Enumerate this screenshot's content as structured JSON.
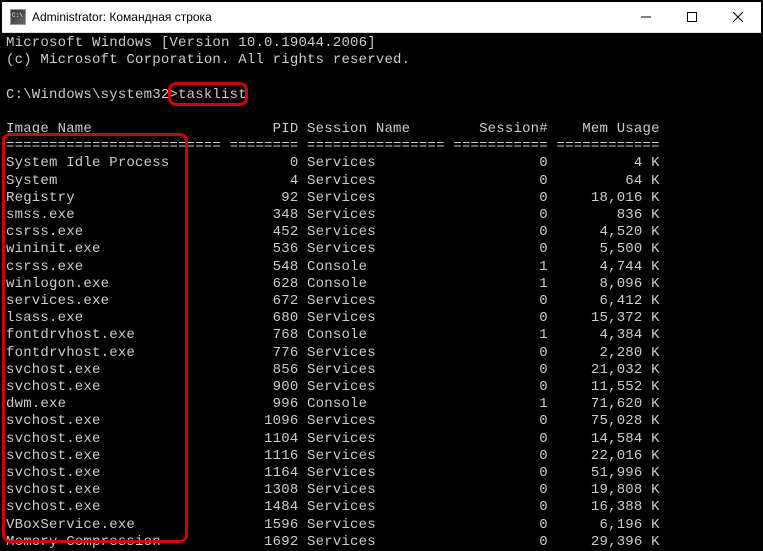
{
  "window": {
    "title": "Administrator: Командная строка"
  },
  "header": {
    "line1": "Microsoft Windows [Version 10.0.19044.2006]",
    "line2": "(c) Microsoft Corporation. All rights reserved."
  },
  "prompt": {
    "path": "C:\\Windows\\system32>",
    "command": "tasklist"
  },
  "columns": {
    "c1": "Image Name",
    "c2": "PID",
    "c3": "Session Name",
    "c4": "Session#",
    "c5": "Mem Usage"
  },
  "sep": "========================= ======== ================ =========== ============",
  "rows": [
    {
      "name": "System Idle Process",
      "pid": "0",
      "sess": "Services",
      "sn": "0",
      "mem": "4 K"
    },
    {
      "name": "System",
      "pid": "4",
      "sess": "Services",
      "sn": "0",
      "mem": "64 K"
    },
    {
      "name": "Registry",
      "pid": "92",
      "sess": "Services",
      "sn": "0",
      "mem": "18,016 K"
    },
    {
      "name": "smss.exe",
      "pid": "348",
      "sess": "Services",
      "sn": "0",
      "mem": "836 K"
    },
    {
      "name": "csrss.exe",
      "pid": "452",
      "sess": "Services",
      "sn": "0",
      "mem": "4,520 K"
    },
    {
      "name": "wininit.exe",
      "pid": "536",
      "sess": "Services",
      "sn": "0",
      "mem": "5,500 K"
    },
    {
      "name": "csrss.exe",
      "pid": "548",
      "sess": "Console",
      "sn": "1",
      "mem": "4,744 K"
    },
    {
      "name": "winlogon.exe",
      "pid": "628",
      "sess": "Console",
      "sn": "1",
      "mem": "8,096 K"
    },
    {
      "name": "services.exe",
      "pid": "672",
      "sess": "Services",
      "sn": "0",
      "mem": "6,412 K"
    },
    {
      "name": "lsass.exe",
      "pid": "680",
      "sess": "Services",
      "sn": "0",
      "mem": "15,372 K"
    },
    {
      "name": "fontdrvhost.exe",
      "pid": "768",
      "sess": "Console",
      "sn": "1",
      "mem": "4,384 K"
    },
    {
      "name": "fontdrvhost.exe",
      "pid": "776",
      "sess": "Services",
      "sn": "0",
      "mem": "2,280 K"
    },
    {
      "name": "svchost.exe",
      "pid": "856",
      "sess": "Services",
      "sn": "0",
      "mem": "21,032 K"
    },
    {
      "name": "svchost.exe",
      "pid": "900",
      "sess": "Services",
      "sn": "0",
      "mem": "11,552 K"
    },
    {
      "name": "dwm.exe",
      "pid": "996",
      "sess": "Console",
      "sn": "1",
      "mem": "71,620 K"
    },
    {
      "name": "svchost.exe",
      "pid": "1096",
      "sess": "Services",
      "sn": "0",
      "mem": "75,028 K"
    },
    {
      "name": "svchost.exe",
      "pid": "1104",
      "sess": "Services",
      "sn": "0",
      "mem": "14,584 K"
    },
    {
      "name": "svchost.exe",
      "pid": "1116",
      "sess": "Services",
      "sn": "0",
      "mem": "22,016 K"
    },
    {
      "name": "svchost.exe",
      "pid": "1164",
      "sess": "Services",
      "sn": "0",
      "mem": "51,996 K"
    },
    {
      "name": "svchost.exe",
      "pid": "1308",
      "sess": "Services",
      "sn": "0",
      "mem": "19,808 K"
    },
    {
      "name": "svchost.exe",
      "pid": "1484",
      "sess": "Services",
      "sn": "0",
      "mem": "16,388 K"
    },
    {
      "name": "VBoxService.exe",
      "pid": "1596",
      "sess": "Services",
      "sn": "0",
      "mem": "6,196 K"
    },
    {
      "name": "Memory Compression",
      "pid": "1692",
      "sess": "Services",
      "sn": "0",
      "mem": "29,396 K"
    }
  ]
}
